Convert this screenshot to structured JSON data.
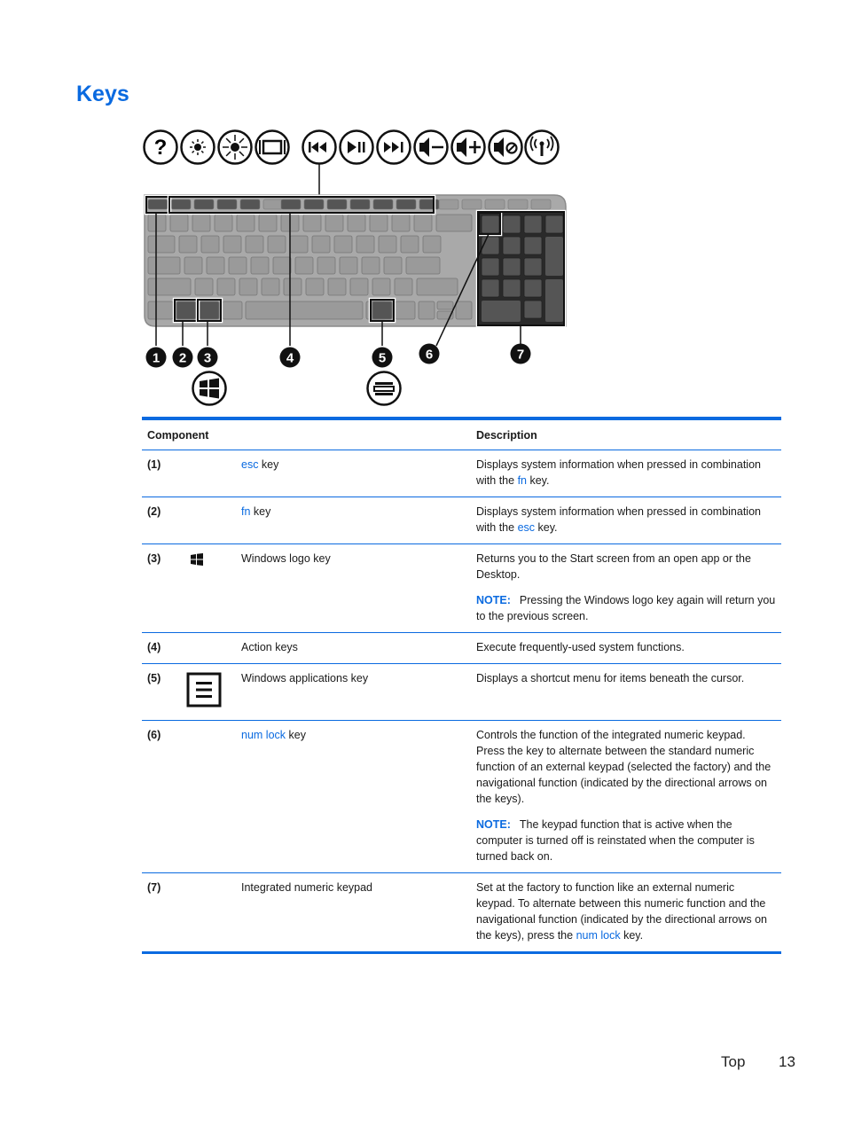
{
  "page": {
    "title": "Keys",
    "footer_section": "Top",
    "page_number": "13"
  },
  "figure": {
    "action_key_icons": [
      "help-icon",
      "brightness-down-icon",
      "brightness-up-icon",
      "switch-display-icon",
      "previous-track-icon",
      "play-pause-icon",
      "next-track-icon",
      "volume-down-icon",
      "volume-up-icon",
      "mute-icon",
      "wireless-icon"
    ],
    "callouts": [
      "1",
      "2",
      "3",
      "4",
      "5",
      "6",
      "7"
    ],
    "callout_icons": [
      "windows-logo-icon",
      "applications-menu-icon"
    ]
  },
  "table": {
    "headers": [
      "Component",
      "Description"
    ],
    "rows": [
      {
        "num": "(1)",
        "icon": "",
        "name_link": "esc",
        "name_rest": " key",
        "desc": [
          {
            "parts": [
              {
                "t": "Displays system information when pressed in combination with the "
              },
              {
                "t": "fn",
                "link": true
              },
              {
                "t": " key."
              }
            ]
          }
        ]
      },
      {
        "num": "(2)",
        "icon": "",
        "name_link": "fn",
        "name_rest": " key",
        "desc": [
          {
            "parts": [
              {
                "t": "Displays system information when pressed in combination with the "
              },
              {
                "t": "esc",
                "link": true
              },
              {
                "t": " key."
              }
            ]
          }
        ]
      },
      {
        "num": "(3)",
        "icon": "windows-logo-icon",
        "name_link": "",
        "name_rest": "Windows logo key",
        "desc": [
          {
            "parts": [
              {
                "t": "Returns you to the Start screen from an open app or the Desktop."
              }
            ]
          },
          {
            "note": "NOTE:",
            "parts": [
              {
                "t": "Pressing the Windows logo key again will return you to the previous screen."
              }
            ]
          }
        ]
      },
      {
        "num": "(4)",
        "icon": "",
        "name_link": "",
        "name_rest": "Action keys",
        "desc": [
          {
            "parts": [
              {
                "t": "Execute frequently-used system functions."
              }
            ]
          }
        ]
      },
      {
        "num": "(5)",
        "icon": "applications-key-icon",
        "name_link": "",
        "name_rest": "Windows applications key",
        "desc": [
          {
            "parts": [
              {
                "t": "Displays a shortcut menu for items beneath the cursor."
              }
            ]
          }
        ]
      },
      {
        "num": "(6)",
        "icon": "",
        "name_link": "num lock",
        "name_rest": " key",
        "desc": [
          {
            "parts": [
              {
                "t": "Controls the function of the integrated numeric keypad. Press the key to alternate between the standard numeric function of an external keypad (selected the factory) and the navigational function (indicated by the directional arrows on the keys)."
              }
            ]
          },
          {
            "note": "NOTE:",
            "parts": [
              {
                "t": "The keypad function that is active when the computer is turned off is reinstated when the computer is turned back on."
              }
            ]
          }
        ]
      },
      {
        "num": "(7)",
        "icon": "",
        "name_link": "",
        "name_rest": "Integrated numeric keypad",
        "desc": [
          {
            "parts": [
              {
                "t": "Set at the factory to function like an external numeric keypad. To alternate between this numeric function and the navigational function (indicated by the directional arrows on the keys), press the "
              },
              {
                "t": "num lock",
                "link": true
              },
              {
                "t": " key."
              }
            ]
          }
        ]
      }
    ]
  },
  "colors": {
    "accent": "#0a6ae0",
    "key_light": "#9a9a9a",
    "key_dark": "#555555"
  }
}
